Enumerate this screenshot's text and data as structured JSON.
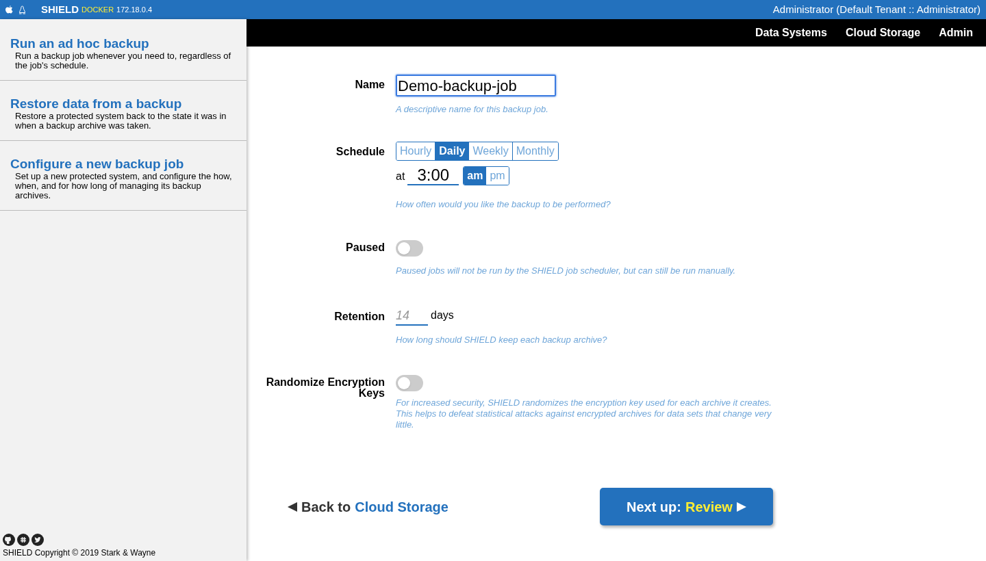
{
  "topbar": {
    "brand": "SHIELD",
    "env": "DOCKER",
    "ip": "172.18.0.4",
    "user": "Administrator (Default Tenant :: Administrator)"
  },
  "sidebar": {
    "items": [
      {
        "title": "Run an ad hoc backup",
        "description": "Run a backup job whenever you need to, regardless of the job's schedule."
      },
      {
        "title": "Restore data from a backup",
        "description": "Restore a protected system back to the state it was in when a backup archive was taken."
      },
      {
        "title": "Configure a new backup job",
        "description": "Set up a new protected system, and configure the how, when, and for how long of managing its backup archives."
      }
    ],
    "copyright": "SHIELD Copyright © 2019 Stark & Wayne"
  },
  "nav": [
    "Data Systems",
    "Cloud Storage",
    "Admin"
  ],
  "form": {
    "name": {
      "label": "Name",
      "value": "Demo-backup-job",
      "hint": "A descriptive name for this backup job."
    },
    "schedule": {
      "label": "Schedule",
      "options": [
        {
          "label": "Hourly",
          "selected": false
        },
        {
          "label": "Daily",
          "selected": true
        },
        {
          "label": "Weekly",
          "selected": false
        },
        {
          "label": "Monthly",
          "selected": false
        }
      ],
      "at": "at",
      "time": "3:00",
      "periods": [
        {
          "label": "am",
          "selected": true
        },
        {
          "label": "pm",
          "selected": false
        }
      ],
      "hint": "How often would you like the backup to be performed?"
    },
    "paused": {
      "label": "Paused",
      "on": false,
      "hint": "Paused jobs will not be run by the SHIELD job scheduler, but can still be run manually."
    },
    "retention": {
      "label": "Retention",
      "placeholder": "14",
      "unit": "days",
      "hint": "How long should SHIELD keep each backup archive?"
    },
    "randomize": {
      "label": "Randomize Encryption Keys",
      "on": false,
      "hint": "For increased security, SHIELD randomizes the encryption key used for each archive it creates. This helps to defeat statistical attacks against encrypted archives for data sets that change very little."
    }
  },
  "footer": {
    "back_prefix": "Back to",
    "back_target": "Cloud Storage",
    "next_prefix": "Next up:",
    "next_target": "Review"
  }
}
